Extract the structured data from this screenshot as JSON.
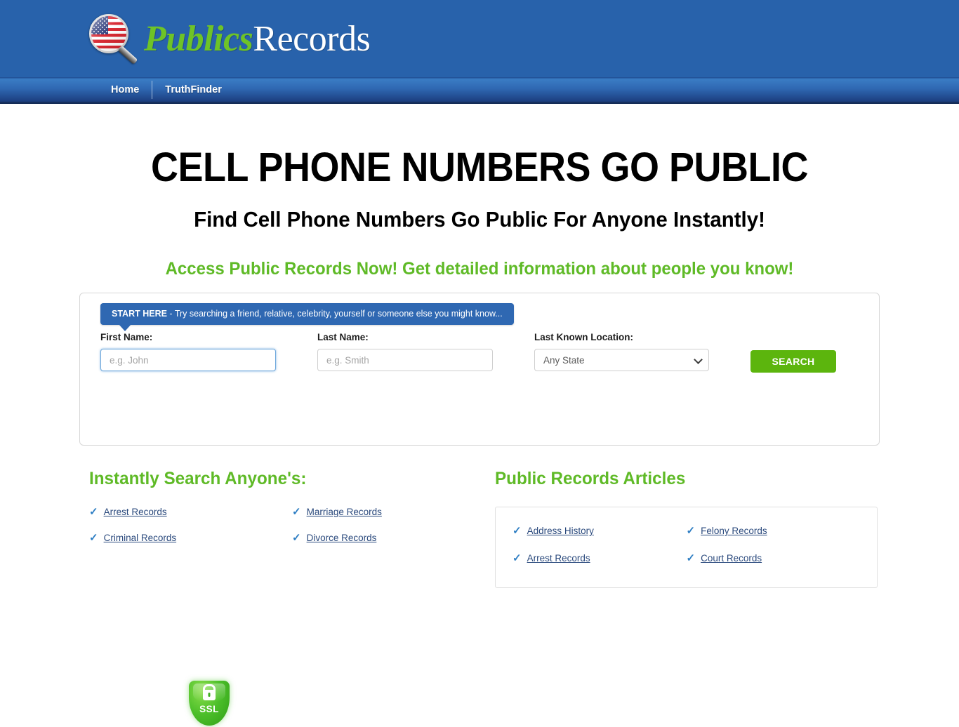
{
  "header": {
    "logo": {
      "flag_icon": "us-flag-icon",
      "magnifier_icon": "magnifying-glass-icon",
      "text_primary": "Publics",
      "text_secondary": "Records"
    }
  },
  "nav": {
    "items": [
      {
        "label": "Home"
      },
      {
        "label": "TruthFinder"
      }
    ]
  },
  "hero": {
    "headline": "CELL PHONE NUMBERS GO PUBLIC",
    "subhead": "Find Cell Phone Numbers Go Public For Anyone Instantly!",
    "tagline": "Access Public Records Now! Get detailed information about people you know!"
  },
  "search": {
    "banner": {
      "strong": "START HERE",
      "rest": " - Try searching a friend, relative, celebrity, yourself or someone else you might know..."
    },
    "first_name": {
      "label": "First Name:",
      "value": "",
      "placeholder": "e.g. John"
    },
    "last_name": {
      "label": "Last Name:",
      "value": "",
      "placeholder": "e.g. Smith"
    },
    "location": {
      "label": "Last Known Location:",
      "selected": "Any State"
    },
    "submit_label": "SEARCH",
    "ssl_badge": {
      "text": "SSL",
      "icon": "padlock-shield-icon"
    }
  },
  "colors": {
    "header_blue": "#2862ab",
    "nav_blue_light": "#3a7cc4",
    "nav_blue_dark": "#1c3f80",
    "green_accent": "#5fba27",
    "search_button_green": "#5cb50d",
    "link_blue": "#2b4a7d",
    "check_blue": "#2f7fc4"
  },
  "left_column": {
    "title": "Instantly Search Anyone's:",
    "links": [
      "Arrest Records",
      "Marriage Records",
      "Criminal Records",
      "Divorce Records"
    ]
  },
  "right_column": {
    "title": "Public Records Articles",
    "links": [
      "Address History",
      "Felony Records",
      "Arrest Records",
      "Court Records"
    ]
  }
}
